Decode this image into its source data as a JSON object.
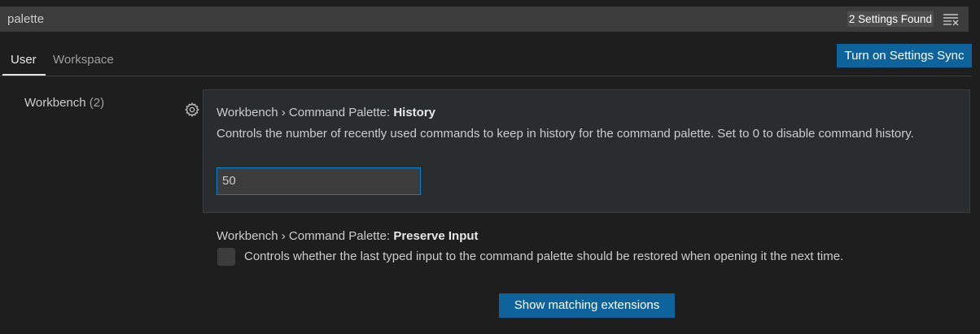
{
  "search": {
    "value": "palette",
    "results_label": "2 Settings Found",
    "clear_icon": "clear-filter-icon"
  },
  "tabs": [
    {
      "label": "User",
      "active": true
    },
    {
      "label": "Workspace",
      "active": false
    }
  ],
  "sync_button_label": "Turn on Settings Sync",
  "toc": {
    "label": "Workbench",
    "count": "(2)"
  },
  "settings": [
    {
      "category": "Workbench › Command Palette: ",
      "name": "History",
      "description": "Controls the number of recently used commands to keep in history for the command palette. Set to 0 to disable command history.",
      "value": "50",
      "gear_icon": "gear-icon"
    },
    {
      "category": "Workbench › Command Palette: ",
      "name": "Preserve Input",
      "description": "Controls whether the last typed input to the command palette should be restored when opening it the next time.",
      "checked": false
    }
  ],
  "extensions_button_label": "Show matching extensions",
  "colors": {
    "accent": "#0e639c",
    "focus_border": "#007fd4",
    "background": "#1e1e1e",
    "input_background": "#3c3c3c"
  }
}
